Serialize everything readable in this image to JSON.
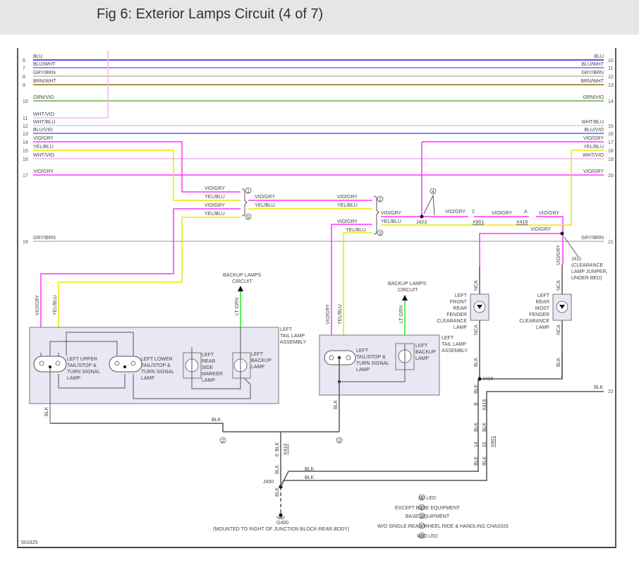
{
  "title": "Fig 6: Exterior Lamps Circuit (4 of 7)",
  "colors": {
    "VIO/GRY": "#ff33ff",
    "YEL/BLU": "#e8e800",
    "BLU": "#1a1aee",
    "BLU/WHT": "#6c6cf4",
    "GRY/BRN": "#bdb6ae",
    "BRN/WHT": "#8c6a10",
    "GRN/VIO": "#6aa84f",
    "WHT/VIO": "#f4b4f4",
    "WHT/BLU": "#cdd0f2",
    "BLU/VIO": "#5c5cff",
    "LT GRN": "#22ee22",
    "BLK": "#555555"
  },
  "wires": [
    {
      "label": "BLU",
      "left": "6",
      "right": "10"
    },
    {
      "label": "BLU/WHT",
      "left": "7",
      "right": "11"
    },
    {
      "label": "GRY/BRN",
      "left": "8",
      "right": "12"
    },
    {
      "label": "BRN/WHT",
      "left": "9",
      "right": "13"
    },
    {
      "label": "GRN/VIO",
      "left": "10",
      "right": "14"
    },
    {
      "label": "WHT/VIO",
      "left": "11",
      "right": ""
    },
    {
      "label": "WHT/BLU",
      "left": "12",
      "right": "15"
    },
    {
      "label": "BLU/VIO",
      "left": "13",
      "right": "16"
    },
    {
      "label": "VIO/GRY",
      "left": "14",
      "right": "17"
    },
    {
      "label": "YEL/BLU",
      "left": "15",
      "right": "18"
    },
    {
      "label": "WHT/VIO",
      "left": "16",
      "right": "19"
    },
    {
      "label": "VIO/GRY",
      "left": "17",
      "right": "20"
    },
    {
      "label": "GRY/BRN",
      "left": "18",
      "right": "21"
    },
    {
      "label": "BLK",
      "left": "",
      "right": "22"
    }
  ],
  "labels": {
    "vio_gry": "VIO/GRY",
    "yel_blu": "YEL/BLU",
    "blk": "BLK",
    "lt_grn": "LT GRN",
    "nca": "NCA",
    "c1": "1",
    "c2": "2",
    "c3": "3",
    "c4": "4",
    "c5": "5",
    "j423": "J423",
    "x901": "X901",
    "x416": "X416",
    "x416_a": "A",
    "x901_2": "2",
    "j411": "J411",
    "j411_desc": [
      "(CLEARANCE",
      "LAMP JUMPER,",
      "UNDER BED)"
    ],
    "j416": "J416",
    "j450": "J450",
    "x410": "X410",
    "x410_6": "6",
    "x416_b": "B",
    "x901_14": "14",
    "x901_15": "15",
    "pin1": "1",
    "pin2": "2",
    "pin3": "3",
    "pinA": "A",
    "pinB": "B",
    "g400": "G400",
    "g400_desc": "(MOUNTED TO RIGHT OF JUNCTION BLOCK-REAR BODY)",
    "backup_circuit": [
      "BACKUP LAMPS",
      "CIRCUIT"
    ],
    "tail_assembly": [
      "LEFT",
      "TAIL LAMP",
      "ASSEMBLY"
    ],
    "upper_lamp": [
      "LEFT UPPER",
      "TAIL/STOP &",
      "TURN SIGNAL",
      "LAMP"
    ],
    "lower_lamp": [
      "LEFT LOWER",
      "TAIL/STOP &",
      "TURN SIGNAL",
      "LAMP"
    ],
    "side_marker": [
      "LEFT",
      "REAR",
      "SIDE",
      "MARKER",
      "LAMP"
    ],
    "backup_lamp": [
      "LEFT",
      "BACKUP",
      "LAMP"
    ],
    "tail_lamp": [
      "LEFT",
      "TAIL/STOP &",
      "TURN SIGNAL",
      "LAMP"
    ],
    "front_clear": [
      "LEFT",
      "FRONT",
      "REAR",
      "FENDER",
      "CLEARANCE",
      "LAMP"
    ],
    "rear_clear": [
      "LEFT",
      "REAR",
      "MOST",
      "FENDER",
      "CLEARANCE",
      "LAMP"
    ],
    "figure_id": "501825"
  },
  "legend": [
    {
      "num": "1",
      "text": "W/ LED"
    },
    {
      "num": "2",
      "text": "EXCEPT BASE EQUIPMENT"
    },
    {
      "num": "3",
      "text": "BASE EQUIPMENT"
    },
    {
      "num": "4",
      "text": "W/O SINGLE REAR WHEEL RIDE & HANDLING CHASSIS"
    },
    {
      "num": "5",
      "text": "W/O LED"
    }
  ]
}
